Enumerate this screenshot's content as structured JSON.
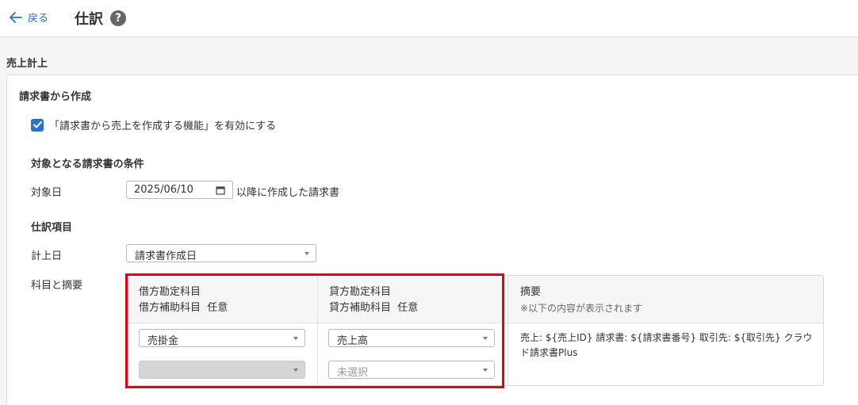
{
  "header": {
    "back_label": "戻る",
    "title": "仕訳",
    "help_glyph": "?"
  },
  "section_title": "売上計上",
  "panel": {
    "heading": "請求書から作成",
    "enable_checkbox": {
      "label": "「請求書から売上を作成する機能」を有効にする",
      "checked": true
    },
    "condition": {
      "heading": "対象となる請求書の条件",
      "date_label": "対象日",
      "date_value": "2025/06/10",
      "date_suffix": "以降に作成した請求書"
    },
    "journal": {
      "heading": "仕訳項目",
      "posting_date_label": "計上日",
      "posting_date_value": "請求書作成日",
      "accounts_label": "科目と摘要"
    },
    "accounts_table": {
      "debit_header": "借方勘定科目",
      "debit_sub_header": "借方補助科目",
      "credit_header": "貸方勘定科目",
      "credit_sub_header": "貸方補助科目",
      "optional_tag": "任意",
      "summary_header": "摘要",
      "summary_note": "※以下の内容が表示されます",
      "debit_account": "売掛金",
      "debit_sub_account": "",
      "credit_account": "売上高",
      "credit_sub_placeholder": "未選択",
      "summary_text": "売上: ${売上ID} 請求書: ${請求書番号} 取引先: ${取引先} クラウド請求書Plus"
    }
  },
  "colors": {
    "accent": "#2a72c8",
    "highlight": "#e60012"
  }
}
